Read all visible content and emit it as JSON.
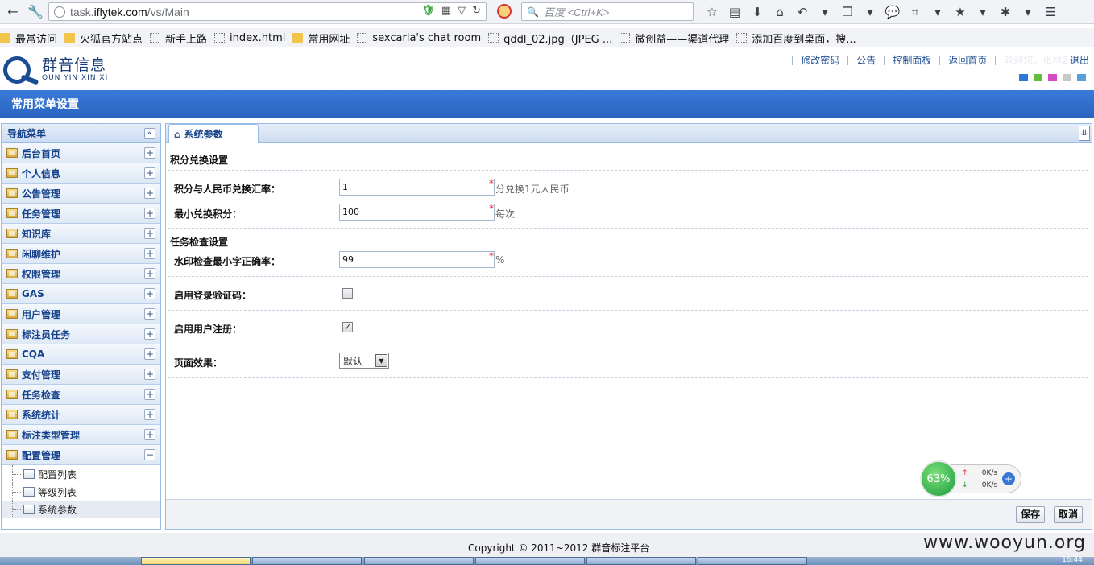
{
  "browser": {
    "url_prefix": "task.",
    "url_domain": "iflytek.com",
    "url_path": "/vs/Main",
    "search_placeholder": "百度 <Ctrl+K>",
    "bookmarks": [
      {
        "label": "最常访问",
        "icon": "folder"
      },
      {
        "label": "火狐官方站点",
        "icon": "folder"
      },
      {
        "label": "新手上路",
        "icon": "page"
      },
      {
        "label": "index.html",
        "icon": "page"
      },
      {
        "label": "常用网址",
        "icon": "folder"
      },
      {
        "label": "sexcarla's chat room",
        "icon": "page"
      },
      {
        "label": "qddl_02.jpg（JPEG ...",
        "icon": "page"
      },
      {
        "label": "微创益——渠道代理",
        "icon": "page"
      },
      {
        "label": "添加百度到桌面，搜...",
        "icon": "page"
      }
    ]
  },
  "header": {
    "logo_cn": "群音信息",
    "logo_en": "QUN YIN XIN XI",
    "links": [
      "修改密码",
      "公告",
      "控制面板",
      "返回首页"
    ],
    "welcome": "欢迎您，张林2",
    "logout": "退出",
    "swatch_colors": [
      "#2b7ad6",
      "#5fbe3a",
      "#d64ac2",
      "#c8c8c8",
      "#5aa0d8"
    ]
  },
  "page_title": "常用菜单设置",
  "sidebar": {
    "title": "导航菜单",
    "collapse_glyph": "«",
    "items": [
      {
        "label": "后台首页",
        "toggle": "+"
      },
      {
        "label": "个人信息",
        "toggle": "+"
      },
      {
        "label": "公告管理",
        "toggle": "+"
      },
      {
        "label": "任务管理",
        "toggle": "+"
      },
      {
        "label": "知识库",
        "toggle": "+"
      },
      {
        "label": "闲聊维护",
        "toggle": "+"
      },
      {
        "label": "权限管理",
        "toggle": "+"
      },
      {
        "label": "GAS",
        "toggle": "+"
      },
      {
        "label": "用户管理",
        "toggle": "+"
      },
      {
        "label": "标注员任务",
        "toggle": "+"
      },
      {
        "label": "CQA",
        "toggle": "+"
      },
      {
        "label": "支付管理",
        "toggle": "+"
      },
      {
        "label": "任务检查",
        "toggle": "+"
      },
      {
        "label": "系统统计",
        "toggle": "+"
      },
      {
        "label": "标注类型管理",
        "toggle": "+"
      },
      {
        "label": "配置管理",
        "toggle": "−"
      }
    ],
    "subitems": [
      {
        "label": "配置列表"
      },
      {
        "label": "等级列表"
      },
      {
        "label": "系统参数"
      }
    ]
  },
  "main": {
    "tab_label": "系统参数",
    "sections": {
      "points": "积分兑换设置",
      "task_check": "任务检查设置"
    },
    "fields": {
      "exchange_rate": {
        "label": "积分与人民币兑换汇率：",
        "value": "1",
        "required": "*",
        "hint": "分兑换1元人民币"
      },
      "min_points": {
        "label": "最小兑换积分：",
        "value": "100",
        "required": "*",
        "hint": "每次"
      },
      "watermark_accuracy": {
        "label": "水印检查最小字正确率：",
        "value": "99",
        "required": "*",
        "hint": "%"
      },
      "login_captcha": {
        "label": "启用登录验证码：",
        "checked": false
      },
      "user_register": {
        "label": "启用用户注册：",
        "checked": true
      },
      "page_effect": {
        "label": "页面效果：",
        "selected": "默认"
      }
    },
    "buttons": {
      "save": "保存",
      "cancel": "取消"
    }
  },
  "speed_widget": {
    "percent": "63%",
    "up": "0K/s",
    "down": "0K/s"
  },
  "footer": {
    "copyright": "Copyright © 2011~2012 群音标注平台",
    "watermark": "www.wooyun.org"
  },
  "taskbar": {
    "clock": "16:44"
  }
}
